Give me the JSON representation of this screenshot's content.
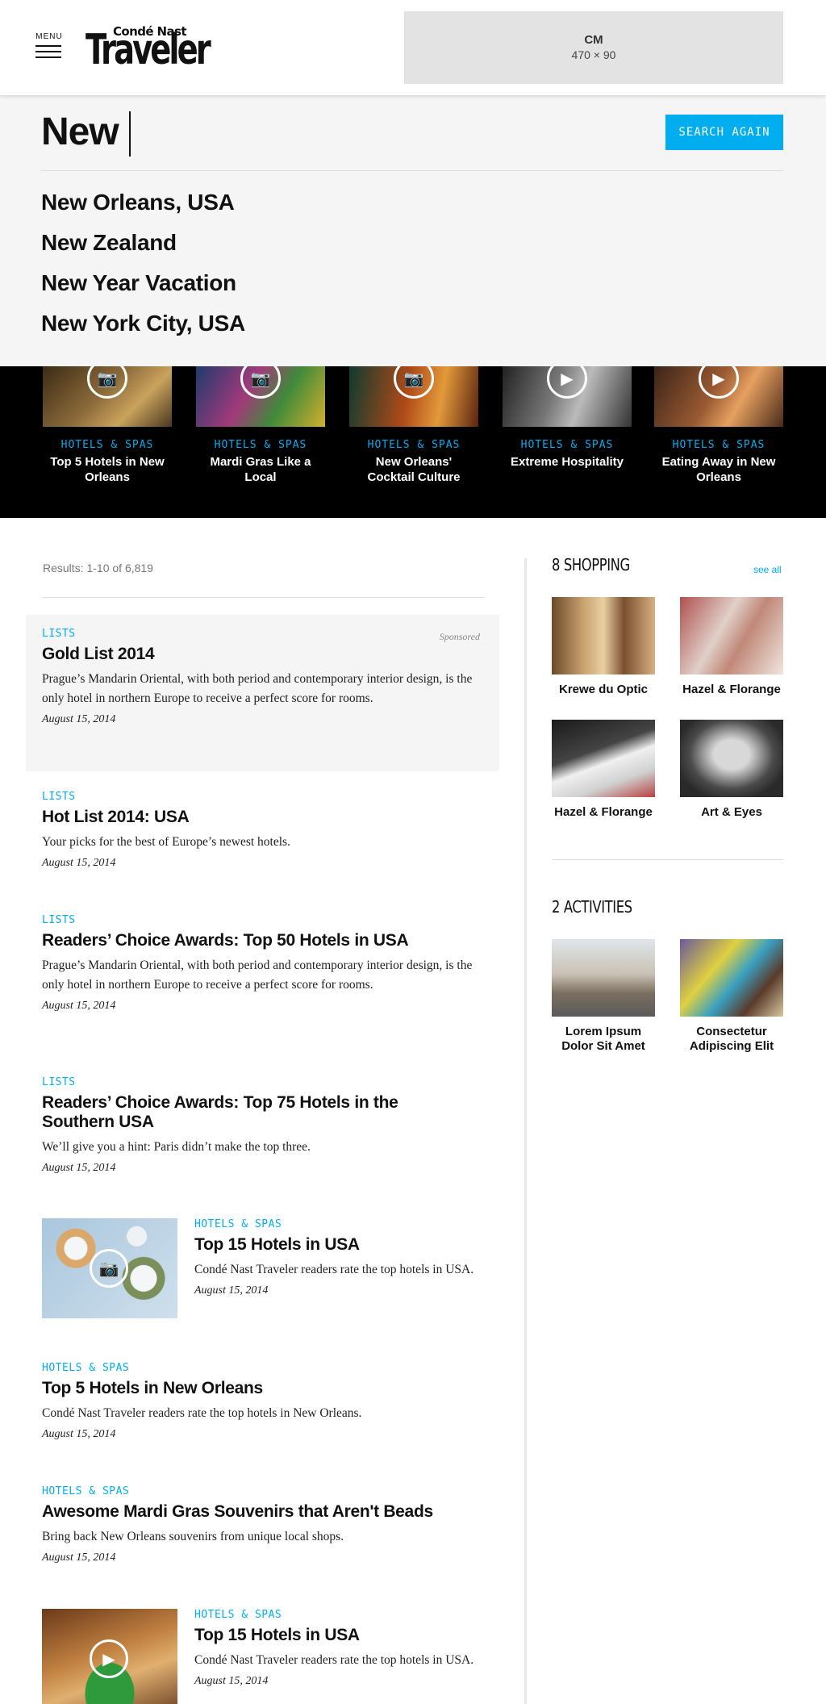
{
  "header": {
    "menu_label": "MENU",
    "logo_top": "Condé Nast",
    "logo_main": "Traveler",
    "ad_title": "CM",
    "ad_size": "470 × 90"
  },
  "search": {
    "query": "New",
    "button_label": "SEARCH AGAIN",
    "suggestions": [
      "New Orleans, USA",
      "New Zealand",
      "New Year Vacation",
      "New York City, USA"
    ]
  },
  "strip": [
    {
      "category": "HOTELS & SPAS",
      "title": "Top 5 Hotels in New Orleans",
      "media": "camera-icon"
    },
    {
      "category": "HOTELS & SPAS",
      "title": "Mardi Gras Like a Local",
      "media": "camera-icon"
    },
    {
      "category": "HOTELS & SPAS",
      "title": "New Orleans' Cocktail Culture",
      "media": "camera-icon"
    },
    {
      "category": "HOTELS & SPAS",
      "title": "Extreme Hospitality",
      "media": "play-icon"
    },
    {
      "category": "HOTELS & SPAS",
      "title": "Eating Away in New Orleans",
      "media": "play-icon"
    }
  ],
  "results": {
    "count_text": "Results: 1-10 of 6,819",
    "sponsored_label": "Sponsored",
    "items": [
      {
        "category": "LISTS",
        "title": "Gold List 2014",
        "description": "Prague’s Mandarin Oriental, with both period and contemporary interior design, is the only hotel in northern Europe to receive a perfect score for rooms.",
        "date": "August 15, 2014"
      },
      {
        "category": "LISTS",
        "title": "Hot List 2014: USA",
        "description": "Your picks for the best of Europe’s newest hotels.",
        "date": "August 15, 2014"
      },
      {
        "category": "LISTS",
        "title": "Readers’ Choice Awards: Top 50 Hotels in USA",
        "description": "Prague’s Mandarin Oriental, with both period and contemporary interior design, is the only hotel in northern Europe to receive a perfect score for rooms.",
        "date": "August 15, 2014"
      },
      {
        "category": "LISTS",
        "title": "Readers’ Choice Awards: Top 75 Hotels in the Southern USA",
        "description": "We’ll give you a hint: Paris didn’t make the top three.",
        "date": "August 15, 2014"
      },
      {
        "category": "HOTELS & SPAS",
        "title": "Top 15 Hotels in USA",
        "description": "Condé Nast Traveler readers rate the top hotels in USA.",
        "date": "August 15, 2014"
      },
      {
        "category": "HOTELS & SPAS",
        "title": "Top 5 Hotels in New Orleans",
        "description": "Condé Nast Traveler readers rate the top hotels in New Orleans.",
        "date": "August 15, 2014"
      },
      {
        "category": "HOTELS & SPAS",
        "title": "Awesome Mardi Gras Souvenirs that Aren't Beads",
        "description": "Bring back New Orleans souvenirs from unique local shops.",
        "date": "August 15, 2014"
      },
      {
        "category": "HOTELS & SPAS",
        "title": "Top 15 Hotels in USA",
        "description": "Condé Nast Traveler readers rate the top hotels in USA.",
        "date": "August 15, 2014"
      }
    ]
  },
  "sidebar": {
    "shopping_heading": "8 SHOPPING",
    "see_all": "see all",
    "shopping": [
      "Krewe du Optic",
      "Hazel & Florange",
      "Hazel & Florange",
      "Art & Eyes"
    ],
    "activities_heading": "2 ACTIVITIES",
    "activities": [
      "Lorem Ipsum Dolor Sit Amet",
      "Consectetur Adipiscing Elit"
    ]
  },
  "colors": {
    "accent": "#00aeef",
    "panel": "#f5f5f5",
    "strip": "#000000"
  }
}
